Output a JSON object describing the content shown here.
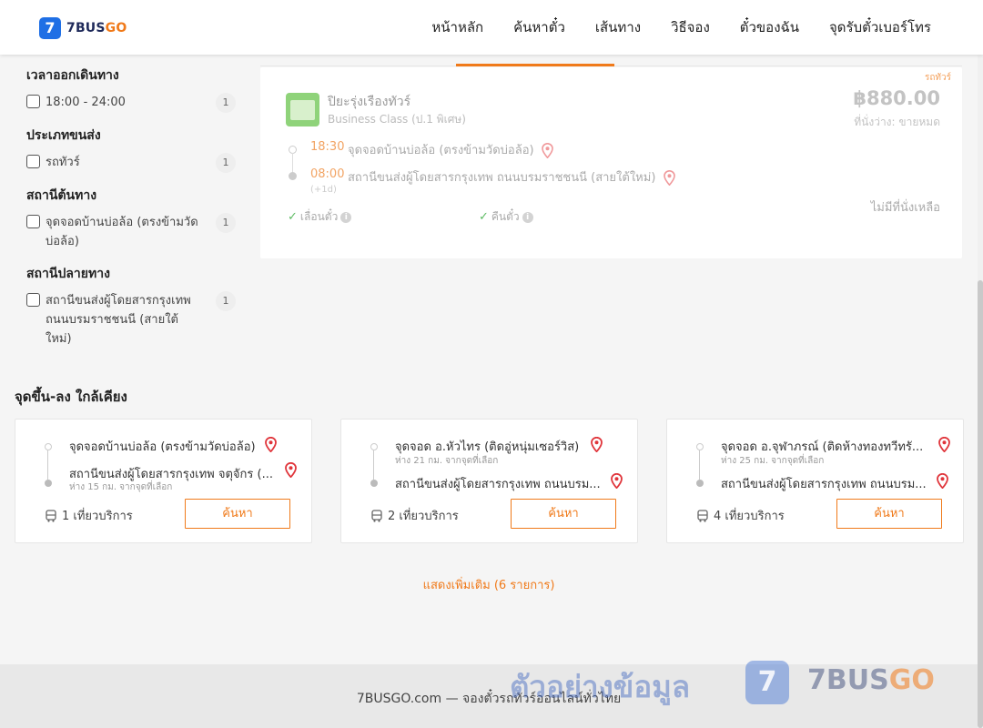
{
  "header": {
    "logo_mark": "7",
    "logo_name": "7BUS",
    "logo_accent": "GO",
    "nav": [
      "หน้าหลัก",
      "ค้นหาตั๋ว",
      "เส้นทาง",
      "วิธีจอง",
      "ตั๋วของฉัน",
      "จุดรับตั๋วเบอร์โทร"
    ]
  },
  "filters": [
    {
      "title": "เวลาออกเดินทาง",
      "options": [
        {
          "label": "18:00 - 24:00",
          "count": "1"
        }
      ]
    },
    {
      "title": "ประเภทขนส่ง",
      "options": [
        {
          "label": "รถทัวร์",
          "count": "1"
        }
      ]
    },
    {
      "title": "สถานีต้นทาง",
      "options": [
        {
          "label": "จุดจอดบ้านบ่อล้อ (ตรงข้ามวัดบ่อล้อ)",
          "count": "1"
        }
      ]
    },
    {
      "title": "สถานีปลายทาง",
      "options": [
        {
          "label": "สถานีขนส่งผู้โดยสารกรุงเทพ ถนนบรมราชชนนี (สายใต้ใหม่)",
          "count": "1"
        }
      ]
    }
  ],
  "trip": {
    "badge": "รถทัวร์",
    "operator": "ปิยะรุ่งเรืองทัวร์",
    "class": "Business Class (ป.1 พิเศษ)",
    "price": "฿880.00",
    "availability": "ที่นั่งว่าง: ขายหมด",
    "depart_time": "18:30",
    "depart_place": "จุดจอดบ้านบ่อล้อ (ตรงข้ามวัดบ่อล้อ)",
    "arrive_time": "08:00",
    "arrive_place": "สถานีขนส่งผู้โดยสารกรุงเทพ ถนนบรมราชชนนี (สายใต้ใหม่)",
    "plus_day": "(+1d)",
    "feature_1": "เลื่อนตั๋ว",
    "feature_2": "คืนตั๋ว",
    "no_seats": "ไม่มีที่นั่งเหลือ"
  },
  "nearby": {
    "title": "จุดขึ้น-ลง ใกล้เคียง",
    "cards": [
      {
        "from": "จุดจอดบ้านบ่อล้อ (ตรงข้ามวัดบ่อล้อ)",
        "from_dist": "",
        "to": "สถานีขนส่งผู้โดยสารกรุงเทพ จตุจักร (...",
        "to_dist": "ห่าง 15 กม. จากจุดที่เลือก",
        "trips": "1 เที่ยวบริการ",
        "button": "ค้นหา"
      },
      {
        "from": "จุดจอด อ.หัวไทร (ติดอู่หนุ่มเซอร์วิส)",
        "from_dist": "ห่าง 21 กม. จากจุดที่เลือก",
        "to": "สถานีขนส่งผู้โดยสารกรุงเทพ ถนนบรม...",
        "to_dist": "",
        "trips": "2 เที่ยวบริการ",
        "button": "ค้นหา"
      },
      {
        "from": "จุดจอด อ.จุฬาภรณ์ (ติดห้างทองทวีทรั...",
        "from_dist": "ห่าง 25 กม. จากจุดที่เลือก",
        "to": "สถานีขนส่งผู้โดยสารกรุงเทพ ถนนบรม...",
        "to_dist": "",
        "trips": "4 เที่ยวบริการ",
        "button": "ค้นหา"
      }
    ],
    "show_more": "แสดงเพิ่มเติม (6 รายการ)"
  },
  "footer": {
    "text": "7BUSGO.com — จองตั๋วรถทัวร์ออนไลน์ทั่วไทย"
  },
  "watermark": {
    "text": "ตัวอย่างข้อมูล",
    "mark": "7",
    "name": "7BUS",
    "accent": "GO"
  },
  "colors": {
    "accent": "#f07a1a",
    "brand_blue": "#1f6fe5",
    "check_green": "#5dbb63",
    "pin_red": "#e0353b"
  }
}
